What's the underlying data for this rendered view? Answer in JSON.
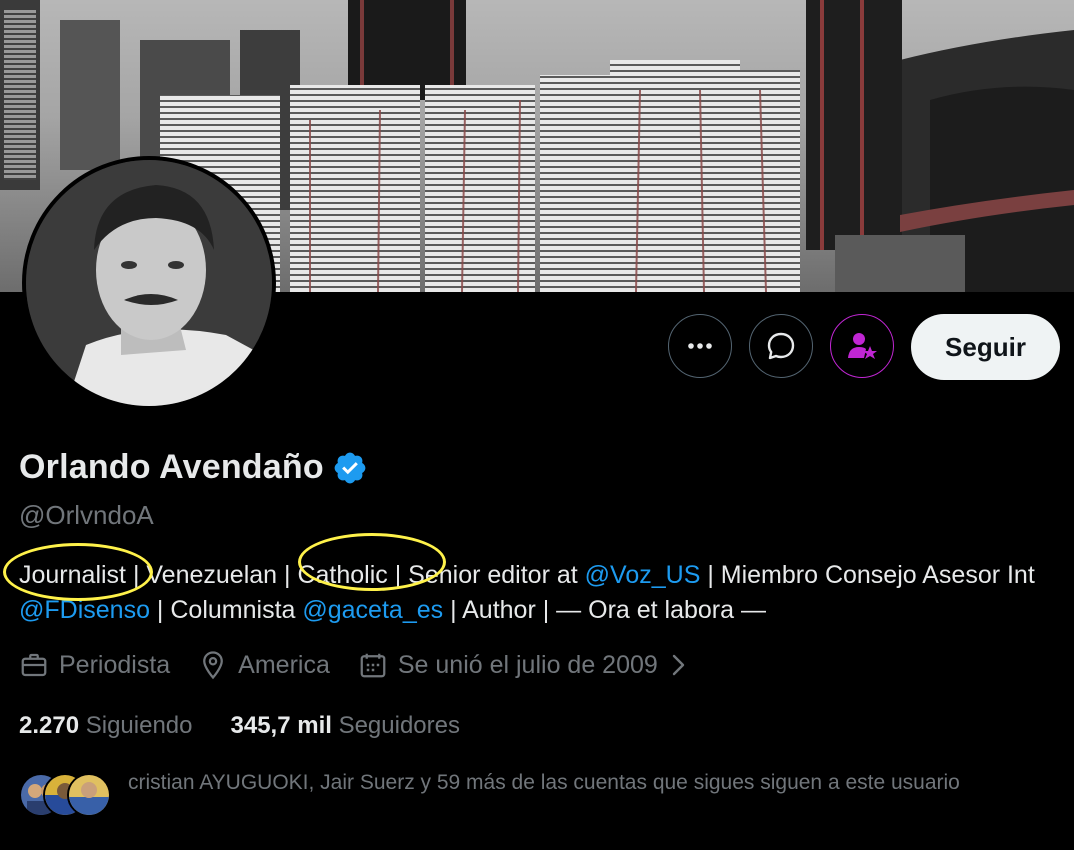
{
  "profile": {
    "name": "Orlando Avendaño",
    "handle": "@OrlvndoA",
    "verified": true,
    "accent_color": "#1d9bf0"
  },
  "actions": {
    "more_icon": "more-horizontal-icon",
    "message_icon": "message-bubble-icon",
    "subscribe_icon": "person-star-icon",
    "follow_label": "Seguir"
  },
  "bio": {
    "part1": "Journalist",
    "part2": " | Venezuelan",
    "part3": " | ",
    "part4": "Catholic",
    "part5": " | Senior editor at ",
    "mention1": "@Voz_US",
    "part6": " | Miembro Consejo Asesor Int ",
    "mention2": "@FDisenso",
    "part7": " | Columnista ",
    "mention3": "@gaceta_es",
    "part8": " | Author | — Ora et labora —"
  },
  "meta": {
    "profession": "Periodista",
    "location": "America",
    "joined": "Se unió el julio de 2009"
  },
  "stats": {
    "following_count": "2.270",
    "following_label": "Siguiendo",
    "followers_count": "345,7 mil",
    "followers_label": "Seguidores"
  },
  "known_followers": {
    "text": "cristian AYUGUOKI, Jair Suerz y 59 más de las cuentas que sigues siguen a este usuario"
  },
  "annotations": {
    "highlight_color": "#fff24a"
  }
}
